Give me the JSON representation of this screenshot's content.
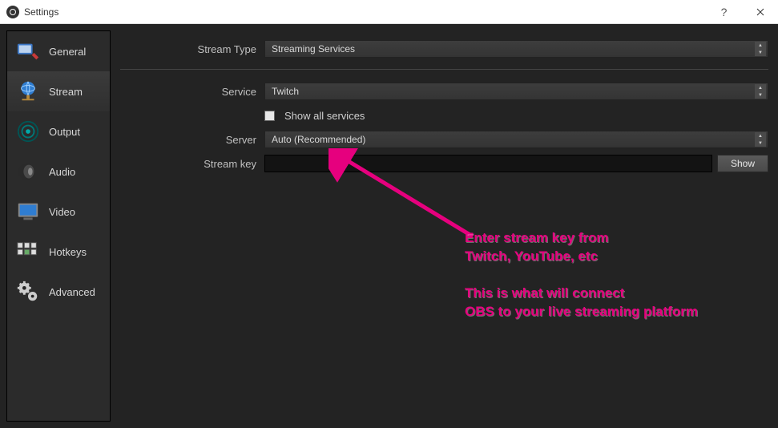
{
  "window": {
    "title": "Settings"
  },
  "sidebar": {
    "items": [
      {
        "label": "General"
      },
      {
        "label": "Stream"
      },
      {
        "label": "Output"
      },
      {
        "label": "Audio"
      },
      {
        "label": "Video"
      },
      {
        "label": "Hotkeys"
      },
      {
        "label": "Advanced"
      }
    ]
  },
  "form": {
    "stream_type": {
      "label": "Stream Type",
      "value": "Streaming Services"
    },
    "service": {
      "label": "Service",
      "value": "Twitch"
    },
    "show_all": {
      "label": "Show all services"
    },
    "server": {
      "label": "Server",
      "value": "Auto (Recommended)"
    },
    "stream_key": {
      "label": "Stream key",
      "value": "",
      "show_button": "Show"
    }
  },
  "annotation": {
    "line1": "Enter stream key from",
    "line2": "Twitch, YouTube, etc",
    "line3": "This is what will connect",
    "line4": "OBS to your live streaming platform"
  }
}
